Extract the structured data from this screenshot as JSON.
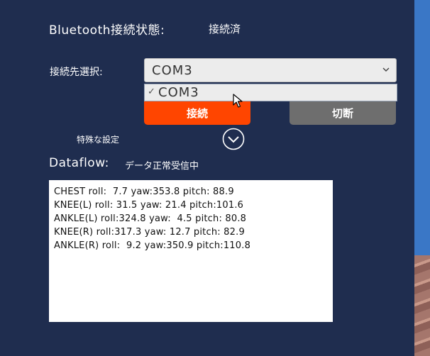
{
  "bluetooth": {
    "label": "Bluetooth接続状態:",
    "status": "接続済"
  },
  "connection": {
    "label": "接続先選択:",
    "selected": "COM3",
    "options": [
      {
        "label": "COM3",
        "checked": true
      }
    ]
  },
  "buttons": {
    "connect": "接続",
    "disconnect": "切断"
  },
  "special_settings": {
    "label": "特殊な設定"
  },
  "dataflow": {
    "label": "Dataflow:",
    "status": "データ正常受信中",
    "lines": [
      "CHEST roll:  7.7 yaw:353.8 pitch: 88.9",
      "KNEE(L) roll: 31.5 yaw: 21.4 pitch:101.6",
      "ANKLE(L) roll:324.8 yaw:  4.5 pitch: 80.8",
      "KNEE(R) roll:317.3 yaw: 12.7 pitch: 82.9",
      "ANKLE(R) roll:  9.2 yaw:350.9 pitch:110.8"
    ]
  },
  "colors": {
    "background": "#1f2d4f",
    "connect_button": "#ff4500",
    "disconnect_button": "#6e6e6e",
    "dropdown": "#ececec",
    "data_panel": "#ffffff"
  },
  "icons": {
    "dropdown": "chevron-down-icon",
    "check": "checkmark-icon",
    "expand": "circle-chevron-down-icon",
    "cursor": "mouse-pointer-icon"
  }
}
